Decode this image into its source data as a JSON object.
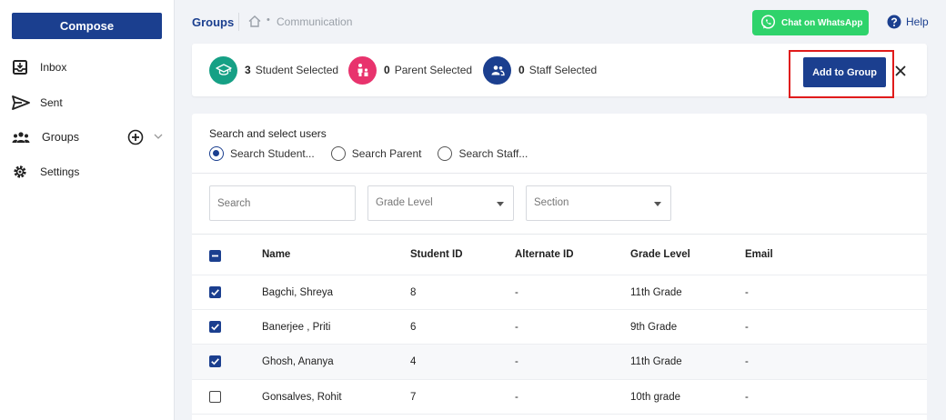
{
  "sidebar": {
    "compose_label": "Compose",
    "items": [
      {
        "label": "Inbox",
        "icon": "inbox-icon"
      },
      {
        "label": "Sent",
        "icon": "send-icon"
      },
      {
        "label": "Groups",
        "icon": "groups-icon"
      },
      {
        "label": "Settings",
        "icon": "gear-icon"
      }
    ]
  },
  "header": {
    "title": "Groups",
    "breadcrumb_current": "Communication",
    "whatsapp_label": "Chat on WhatsApp",
    "help_label": "Help"
  },
  "selection": {
    "student": {
      "count": "3",
      "label": "Student Selected",
      "color": "#16a085"
    },
    "parent": {
      "count": "0",
      "label": "Parent Selected",
      "color": "#e8336d"
    },
    "staff": {
      "count": "0",
      "label": "Staff Selected",
      "color": "#1b3f8f"
    },
    "add_label": "Add to Group"
  },
  "panel": {
    "title": "Search and select users",
    "radios": [
      {
        "label": "Search Student...",
        "selected": true
      },
      {
        "label": "Search Parent",
        "selected": false
      },
      {
        "label": "Search Staff...",
        "selected": false
      }
    ],
    "search_placeholder": "Search",
    "grade_placeholder": "Grade Level",
    "section_placeholder": "Section"
  },
  "table": {
    "headers": {
      "name": "Name",
      "student_id": "Student ID",
      "alt_id": "Alternate ID",
      "grade": "Grade Level",
      "email": "Email"
    },
    "rows": [
      {
        "name": "Bagchi, Shreya",
        "student_id": "8",
        "alt_id": "-",
        "grade": "11th Grade",
        "email": "-",
        "checked": true
      },
      {
        "name": "Banerjee , Priti",
        "student_id": "6",
        "alt_id": "-",
        "grade": "9th Grade",
        "email": "-",
        "checked": true
      },
      {
        "name": "Ghosh, Ananya",
        "student_id": "4",
        "alt_id": "-",
        "grade": "11th Grade",
        "email": "-",
        "checked": true
      },
      {
        "name": "Gonsalves, Rohit",
        "student_id": "7",
        "alt_id": "-",
        "grade": "10th grade",
        "email": "-",
        "checked": false
      }
    ]
  },
  "colors": {
    "primary": "#1b3f8f",
    "whatsapp": "#2fd36b",
    "highlight": "#e01b1b"
  }
}
